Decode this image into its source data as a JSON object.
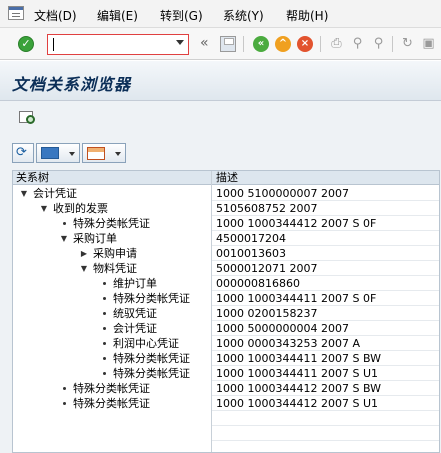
{
  "menu": {
    "items": [
      "文档(D)",
      "编辑(E)",
      "转到(G)",
      "系统(Y)",
      "帮助(H)"
    ]
  },
  "toolbar": {
    "command_field_value": "",
    "icons": [
      "ok-icon",
      "save-icon",
      "back-icon",
      "exit-icon",
      "cancel-icon",
      "print-icon",
      "find-icon",
      "find-next-icon",
      "settings-icon",
      "new-session-icon"
    ]
  },
  "page": {
    "title": "文档关系浏览器"
  },
  "tree": {
    "columns": [
      "关系树",
      "描述"
    ],
    "rows": [
      {
        "label": "会计凭证",
        "desc": "1000 5100000007 2007",
        "level": 0,
        "marker": "expanded"
      },
      {
        "label": "收到的发票",
        "desc": "5105608752 2007",
        "level": 1,
        "marker": "expanded"
      },
      {
        "label": "特殊分类帐凭证",
        "desc": "1000 1000344412 2007 S 0F",
        "level": 2,
        "marker": "leaf"
      },
      {
        "label": "采购订单",
        "desc": "4500017204",
        "level": 2,
        "marker": "expanded"
      },
      {
        "label": "采购申请",
        "desc": "0010013603",
        "level": 3,
        "marker": "collapsed"
      },
      {
        "label": "物料凭证",
        "desc": "5000012071 2007",
        "level": 3,
        "marker": "expanded"
      },
      {
        "label": "维护订单",
        "desc": "000000816860",
        "level": 4,
        "marker": "leaf"
      },
      {
        "label": "特殊分类帐凭证",
        "desc": "1000 1000344411 2007 S 0F",
        "level": 4,
        "marker": "leaf"
      },
      {
        "label": "统驭凭证",
        "desc": "1000 0200158237",
        "level": 4,
        "marker": "leaf"
      },
      {
        "label": "会计凭证",
        "desc": "1000 5000000004 2007",
        "level": 4,
        "marker": "leaf"
      },
      {
        "label": "利润中心凭证",
        "desc": "1000 0000343253 2007 A",
        "level": 4,
        "marker": "leaf"
      },
      {
        "label": "特殊分类帐凭证",
        "desc": "1000 1000344411 2007 S BW",
        "level": 4,
        "marker": "leaf"
      },
      {
        "label": "特殊分类帐凭证",
        "desc": "1000 1000344411 2007 S U1",
        "level": 4,
        "marker": "leaf"
      },
      {
        "label": "特殊分类帐凭证",
        "desc": "1000 1000344412 2007 S BW",
        "level": 2,
        "marker": "leaf"
      },
      {
        "label": "特殊分类帐凭证",
        "desc": "1000 1000344412 2007 S U1",
        "level": 2,
        "marker": "leaf"
      }
    ]
  },
  "colors": {
    "title_text": "#0b2e57",
    "header_bg": "#dde6ee",
    "command_field_border": "#e04040"
  }
}
